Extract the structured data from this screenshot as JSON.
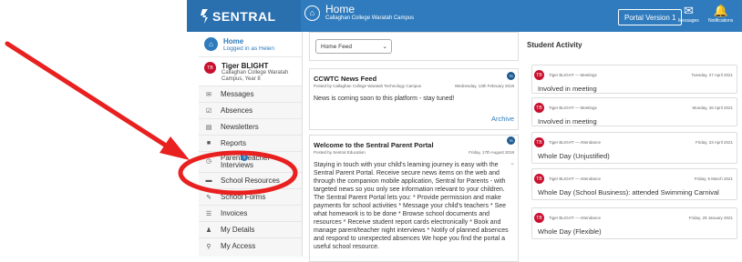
{
  "app": {
    "brand": "SENTRAL",
    "brand_color": "#2f7bbd"
  },
  "header": {
    "home_title": "Home",
    "home_subtitle": "Callaghan College Waratah Campus",
    "portal_button": "Portal Version 1",
    "messages_label": "Messages",
    "notifications_label": "Notifications"
  },
  "sidebar": {
    "home_label": "Home",
    "logged_in": "Logged in as Helen",
    "user_initials": "TB",
    "user_name": "Tiger BLIGHT",
    "user_sub1": "Callaghan College Waratah",
    "user_sub2": "Campus, Year 8",
    "items": [
      {
        "label": "Messages",
        "icon": "envelope-icon"
      },
      {
        "label": "Absences",
        "icon": "check-square-icon"
      },
      {
        "label": "Newsletters",
        "icon": "newspaper-icon"
      },
      {
        "label": "Reports",
        "icon": "report-icon"
      },
      {
        "label": "Parent Teacher Interviews",
        "icon": "clock-icon",
        "badge": "1"
      },
      {
        "label": "School Resources",
        "icon": "folder-icon"
      },
      {
        "label": "School Forms",
        "icon": "form-icon"
      },
      {
        "label": "Invoices",
        "icon": "list-icon"
      },
      {
        "label": "My Details",
        "icon": "user-icon"
      },
      {
        "label": "My Access",
        "icon": "key-icon"
      }
    ]
  },
  "main": {
    "feed_select": "Home Feed",
    "news1": {
      "title": "CCWTC News Feed",
      "posted_by": "Posted by Callaghan College Waratah Technology Campus",
      "date": "Wednesday, 13th February 2019",
      "body": "News is coming soon to this platform - stay tuned!",
      "archive": "Archive",
      "avatar": "TB"
    },
    "news2": {
      "title": "Welcome to the Sentral Parent Portal",
      "posted_by": "Posted by Sentral Education",
      "date": "Friday, 17th August 2018",
      "avatar": "TB",
      "body": "Staying in touch with your child's learning journey is easy with the Sentral Parent Portal. Receive secure news items on the web and through the companion mobile application, Sentral for Parents - with targeted news so you only see information relevant to your children. The Sentral Parent Portal lets you: * Provide permission and make payments for school activities * Message your child's teachers * See what homework is to be done * Browse school documents and resources * Receive student report cards electronically * Book and manage parent/teacher night interviews * Notify of planned absences and respond to unexpected absences We hope you find the portal a useful school resource."
    }
  },
  "activity": {
    "title": "Student Activity",
    "items": [
      {
        "initials": "TB",
        "source": "Tiger BLIGHT — Meetings",
        "date": "Tuesday, 27 April 2021",
        "text": "Involved in meeting"
      },
      {
        "initials": "TB",
        "source": "Tiger BLIGHT — Meetings",
        "date": "Monday, 26 April 2021",
        "text": "Involved in meeting"
      },
      {
        "initials": "TB",
        "source": "Tiger BLIGHT — Attendance",
        "date": "Friday, 23 April 2021",
        "text": "Whole Day (Unjustified)"
      },
      {
        "initials": "TB",
        "source": "Tiger BLIGHT — Attendance",
        "date": "Friday, 5 March 2021",
        "text": "Whole Day (School Business): attended Swimming Carnival"
      },
      {
        "initials": "TB",
        "source": "Tiger BLIGHT — Attendance",
        "date": "Friday, 29 January 2021",
        "text": "Whole Day (Flexible)"
      }
    ]
  },
  "annotation": {
    "color": "#e8201f"
  }
}
